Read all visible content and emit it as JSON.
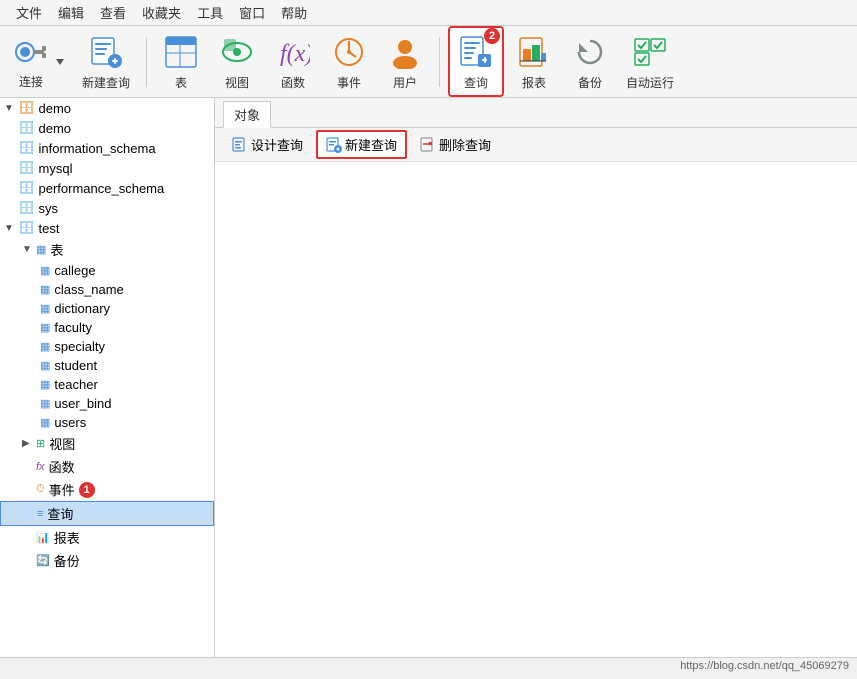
{
  "menubar": {
    "items": [
      "文件",
      "编辑",
      "查看",
      "收藏夹",
      "工具",
      "窗口",
      "帮助"
    ]
  },
  "toolbar": {
    "connect_label": "连接",
    "new_query_label": "新建查询",
    "table_label": "表",
    "view_label": "视图",
    "func_label": "函数",
    "event_label": "事件",
    "user_label": "用户",
    "query_label": "查询",
    "report_label": "报表",
    "backup_label": "备份",
    "auto_label": "自动运行"
  },
  "sidebar": {
    "root_label": "demo",
    "databases": [
      {
        "name": "demo",
        "icon": "db"
      },
      {
        "name": "information_schema",
        "icon": "db"
      },
      {
        "name": "mysql",
        "icon": "db"
      },
      {
        "name": "performance_schema",
        "icon": "db"
      },
      {
        "name": "sys",
        "icon": "db"
      }
    ],
    "test": {
      "label": "test",
      "tables_label": "表",
      "tables": [
        "callege",
        "class_name",
        "dictionary",
        "faculty",
        "specialty",
        "student",
        "teacher",
        "user_bind",
        "users"
      ],
      "views_label": "视图",
      "funcs_label": "函数",
      "events_label": "事件",
      "queries_label": "查询",
      "reports_label": "报表",
      "backups_label": "备份"
    }
  },
  "content": {
    "tab_label": "对象",
    "btn_design": "设计查询",
    "btn_new": "新建查询",
    "btn_delete": "删除查询"
  },
  "statusbar": {
    "url": "https://blog.csdn.net/qq_45069279"
  },
  "badges": {
    "event_badge": "1",
    "query_toolbar_badge": "2"
  }
}
